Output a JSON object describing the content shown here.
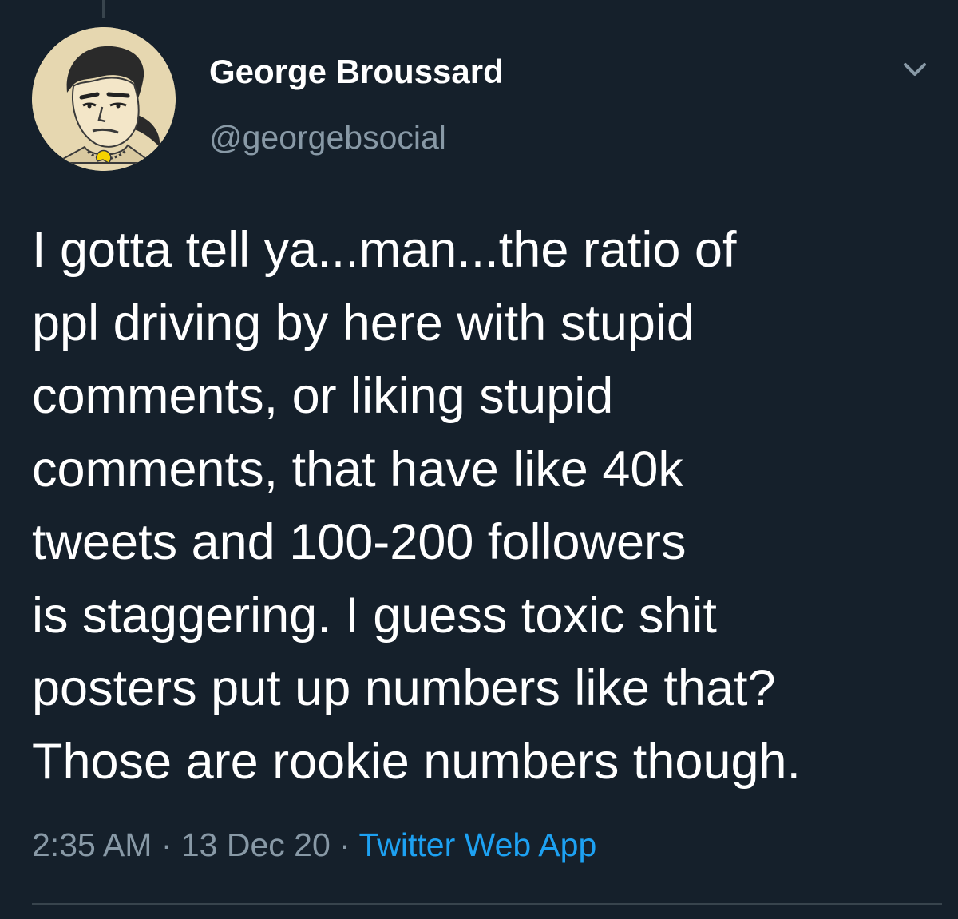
{
  "user": {
    "display_name": "George Broussard",
    "handle": "@georgebsocial",
    "avatar_icon": "cartoon-avatar"
  },
  "tweet": {
    "lines": [
      "I gotta tell ya...man...the ratio of",
      "ppl driving by here with stupid",
      "comments, or liking stupid",
      "comments, that have like 40k",
      "tweets and 100-200 followers",
      "is staggering. I guess toxic shit",
      "posters put up numbers like that?",
      "Those are rookie numbers though."
    ],
    "time": "2:35 AM",
    "date": "13 Dec 20",
    "separator": " · ",
    "source": "Twitter Web App"
  },
  "menu": {
    "icon": "chevron-down-icon"
  },
  "colors": {
    "background": "#15202b",
    "text_primary": "#ffffff",
    "text_secondary": "#8899a6",
    "link": "#1da1f2",
    "divider": "#38444d"
  }
}
